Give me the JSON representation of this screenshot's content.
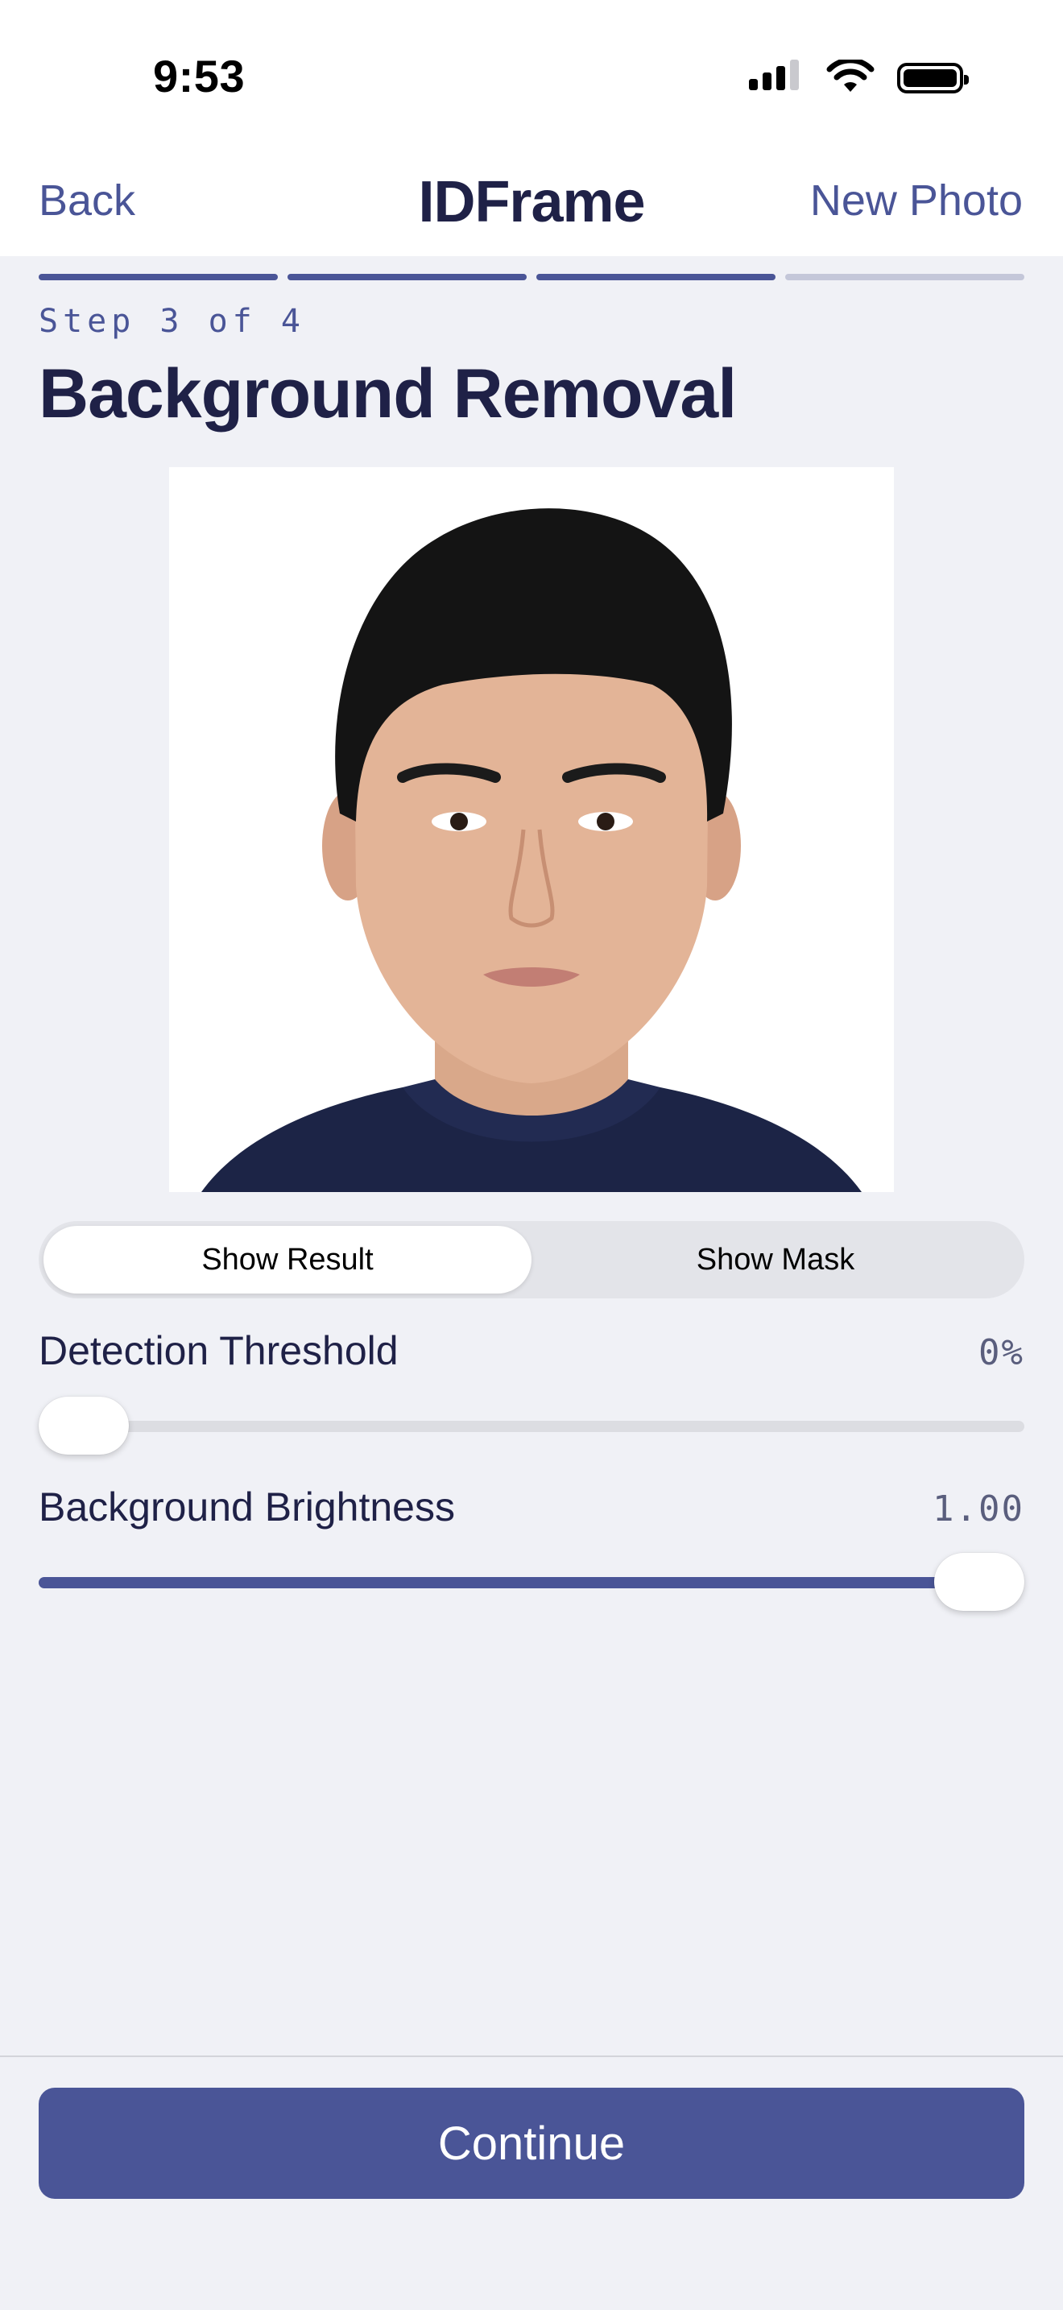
{
  "status_bar": {
    "time": "9:53",
    "icons": [
      "cellular-signal-icon",
      "wifi-icon",
      "battery-icon"
    ]
  },
  "nav": {
    "back_label": "Back",
    "title": "IDFrame",
    "new_photo_label": "New Photo"
  },
  "progress": {
    "total_steps": 4,
    "completed_steps": 3
  },
  "step": {
    "label": "Step 3 of 4",
    "title": "Background Removal"
  },
  "photo": {
    "description_icon": "portrait-photo"
  },
  "view_toggle": {
    "options": [
      "Show Result",
      "Show Mask"
    ],
    "selected": "Show Result"
  },
  "sliders": {
    "detection_threshold": {
      "label": "Detection Threshold",
      "value_text": "0%",
      "fraction": 0.0
    },
    "background_brightness": {
      "label": "Background Brightness",
      "value_text": "1.00",
      "fraction": 1.0
    }
  },
  "footer": {
    "continue_label": "Continue"
  },
  "colors": {
    "accent": "#4A5597",
    "accent_inactive": "#C4C7D9",
    "background": "#F0F1F6",
    "title_text": "#1F2147"
  }
}
